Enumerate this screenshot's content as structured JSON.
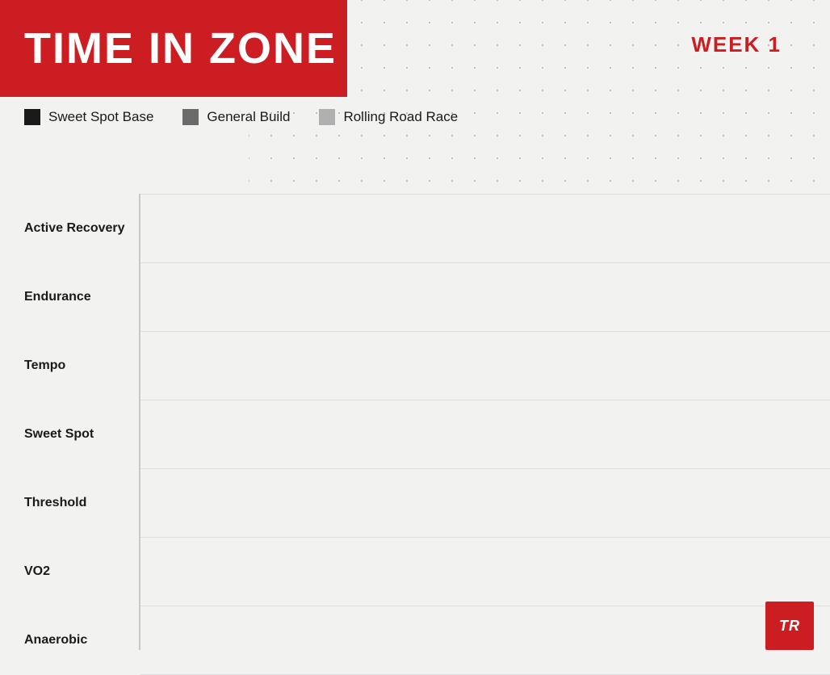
{
  "header": {
    "title": "TIME IN ZONE",
    "week_label": "WEEK 1"
  },
  "legend": {
    "items": [
      {
        "id": "sweet-spot-base",
        "label": "Sweet Spot Base",
        "color": "#1a1a1a"
      },
      {
        "id": "general-build",
        "label": "General Build",
        "color": "#6b6b6b"
      },
      {
        "id": "rolling-road-race",
        "label": "Rolling Road Race",
        "color": "#b0b0b0"
      }
    ]
  },
  "zones": [
    {
      "id": "active-recovery",
      "label": "Active Recovery"
    },
    {
      "id": "endurance",
      "label": "Endurance"
    },
    {
      "id": "tempo",
      "label": "Tempo"
    },
    {
      "id": "sweet-spot",
      "label": "Sweet Spot"
    },
    {
      "id": "threshold",
      "label": "Threshold"
    },
    {
      "id": "vo2",
      "label": "VO2"
    },
    {
      "id": "anaerobic",
      "label": "Anaerobic"
    }
  ],
  "tr_logo": {
    "text": "TR"
  }
}
